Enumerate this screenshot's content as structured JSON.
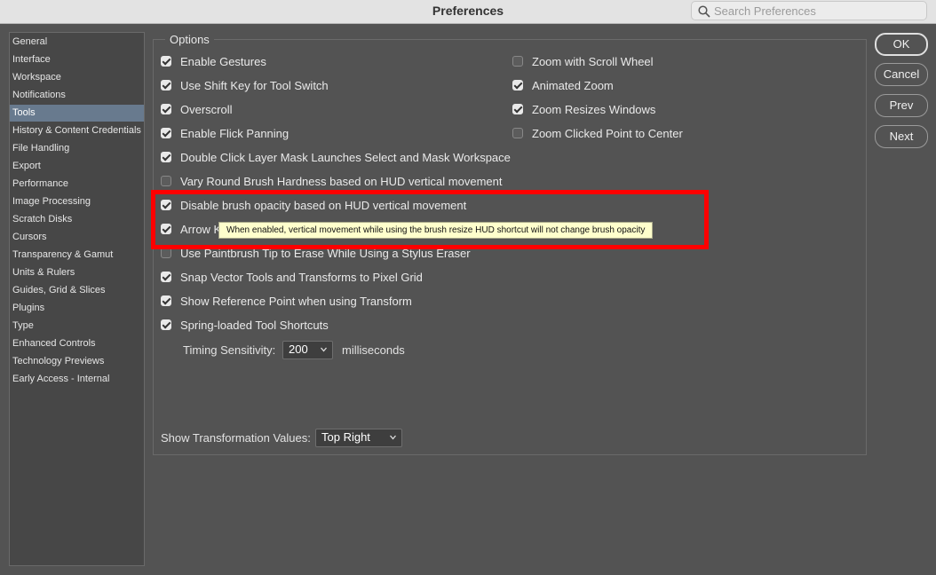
{
  "window": {
    "title": "Preferences"
  },
  "search": {
    "placeholder": "Search Preferences"
  },
  "sidebar": {
    "items": [
      {
        "label": "General"
      },
      {
        "label": "Interface"
      },
      {
        "label": "Workspace"
      },
      {
        "label": "Notifications"
      },
      {
        "label": "Tools",
        "selected": true
      },
      {
        "label": "History & Content Credentials"
      },
      {
        "label": "File Handling"
      },
      {
        "label": "Export"
      },
      {
        "label": "Performance"
      },
      {
        "label": "Image Processing"
      },
      {
        "label": "Scratch Disks"
      },
      {
        "label": "Cursors"
      },
      {
        "label": "Transparency & Gamut"
      },
      {
        "label": "Units & Rulers"
      },
      {
        "label": "Guides, Grid & Slices"
      },
      {
        "label": "Plugins"
      },
      {
        "label": "Type"
      },
      {
        "label": "Enhanced Controls"
      },
      {
        "label": "Technology Previews"
      },
      {
        "label": "Early Access - Internal"
      }
    ]
  },
  "options": {
    "group_label": "Options",
    "left_column": [
      {
        "label": "Enable Gestures",
        "checked": true
      },
      {
        "label": "Use Shift Key for Tool Switch",
        "checked": true
      },
      {
        "label": "Overscroll",
        "checked": true
      },
      {
        "label": "Enable Flick Panning",
        "checked": true
      },
      {
        "label": "Double Click Layer Mask Launches Select and Mask Workspace",
        "checked": true
      },
      {
        "label": "Vary Round Brush Hardness based on HUD vertical movement",
        "checked": false
      },
      {
        "label": "Disable brush opacity based on HUD vertical movement",
        "checked": true
      },
      {
        "label": "Arrow K",
        "checked": true
      },
      {
        "label": "Use Paintbrush Tip to Erase While Using a Stylus Eraser",
        "checked": false
      },
      {
        "label": "Snap Vector Tools and Transforms to Pixel Grid",
        "checked": true
      },
      {
        "label": "Show Reference Point when using Transform",
        "checked": true
      },
      {
        "label": "Spring-loaded Tool Shortcuts",
        "checked": true
      }
    ],
    "right_column": [
      {
        "label": "Zoom with Scroll Wheel",
        "checked": false
      },
      {
        "label": "Animated Zoom",
        "checked": true
      },
      {
        "label": "Zoom Resizes Windows",
        "checked": true
      },
      {
        "label": "Zoom Clicked Point to Center",
        "checked": false
      }
    ],
    "timing": {
      "label": "Timing Sensitivity:",
      "value": "200",
      "unit": "milliseconds"
    },
    "transformation": {
      "label": "Show Transformation Values:",
      "value": "Top Right"
    },
    "tooltip": "When enabled, vertical movement while using the brush resize HUD shortcut will not change brush opacity"
  },
  "buttons": {
    "ok": "OK",
    "cancel": "Cancel",
    "prev": "Prev",
    "next": "Next"
  },
  "colors": {
    "highlight_box": "#ff0000",
    "selected_item": "#687a8e",
    "tooltip_bg": "#ffffcc"
  }
}
